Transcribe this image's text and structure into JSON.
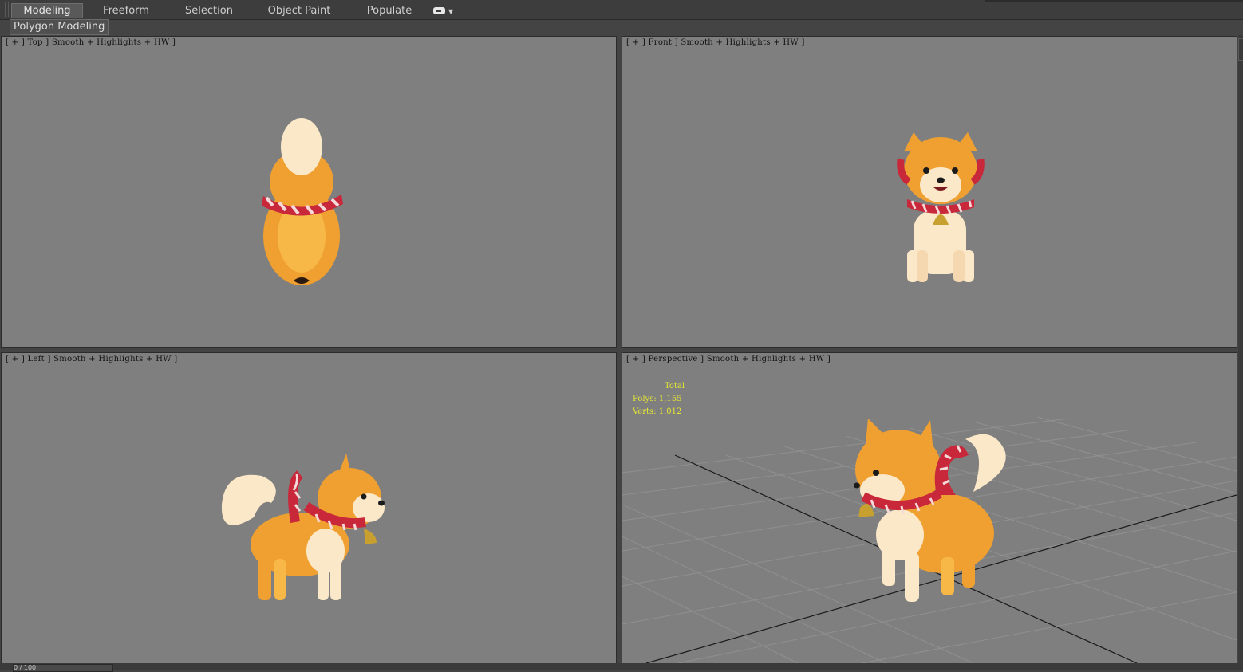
{
  "ribbon": {
    "tabs": [
      {
        "label": "Modeling",
        "active": true
      },
      {
        "label": "Freeform",
        "active": false
      },
      {
        "label": "Selection",
        "active": false
      },
      {
        "label": "Object Paint",
        "active": false
      },
      {
        "label": "Populate",
        "active": false
      }
    ],
    "extra_icon": "toggle-icon",
    "panel_label": "Polygon Modeling"
  },
  "viewports": {
    "top": {
      "label": "[ + ] Top ] Smooth + Highlights + HW ]"
    },
    "front": {
      "label": "[ + ] Front ] Smooth + Highlights + HW ]"
    },
    "left": {
      "label": "[ + ] Left ] Smooth + Highlights + HW ]"
    },
    "perspective": {
      "label": "[ + ] Perspective ] Smooth + Highlights + HW ]",
      "stats": {
        "title": "Total",
        "polys": "Polys: 1,155",
        "verts": "Verts: 1,012"
      }
    }
  },
  "colors": {
    "viewport_bg": "#7f7f7f",
    "stats_text": "#e8e833",
    "fur_orange": "#f0a030",
    "fur_cream": "#fbe8c8",
    "scarf_red": "#c8283a",
    "bell_gold": "#c8a030"
  },
  "statusbar": {
    "frame_counter": "0 / 100"
  }
}
